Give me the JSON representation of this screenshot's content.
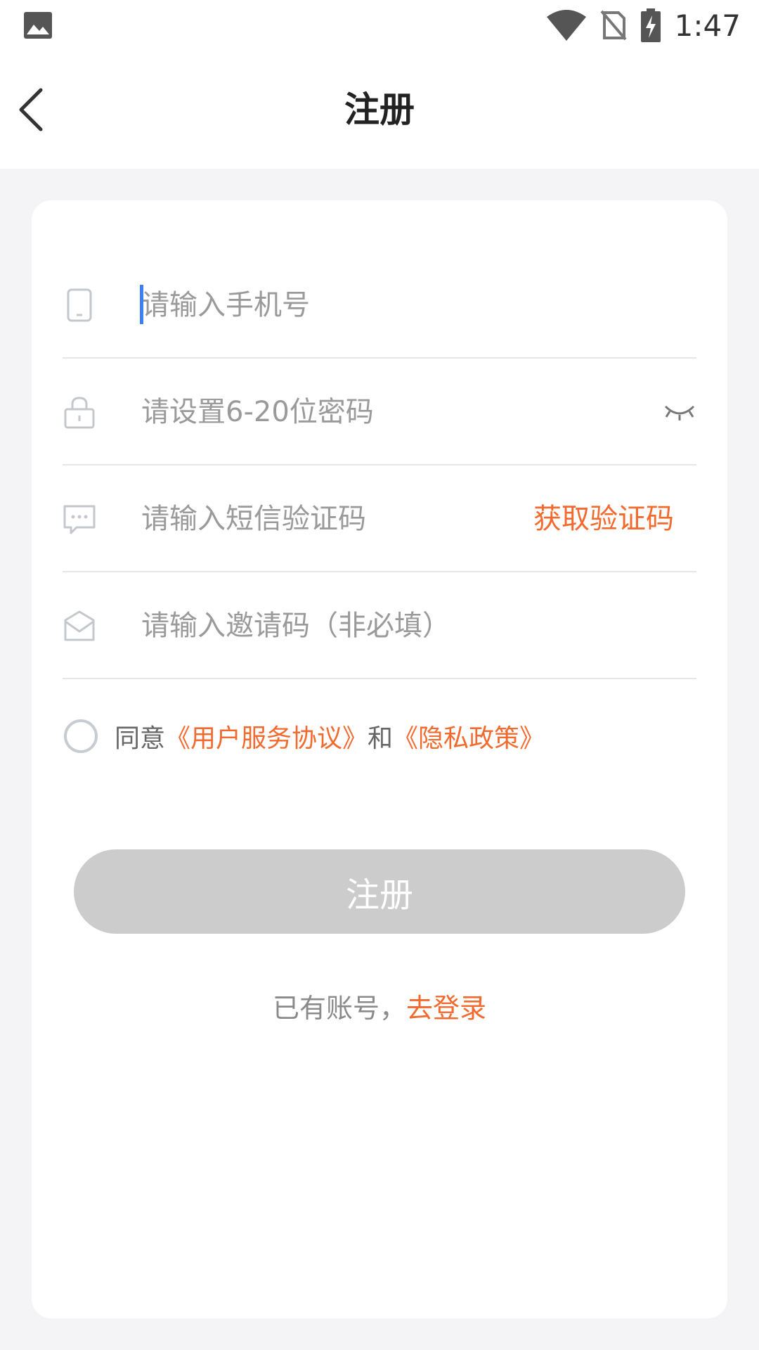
{
  "status_bar": {
    "time": "1:47",
    "icons": [
      "gallery-icon",
      "wifi-icon",
      "no-sim-icon",
      "battery-charging-icon"
    ]
  },
  "nav": {
    "title": "注册",
    "back_icon": "chevron-left-icon"
  },
  "form": {
    "phone_placeholder": "请输入手机号",
    "password_placeholder": "请设置6-20位密码",
    "sms_placeholder": "请输入短信验证码",
    "get_code_label": "获取验证码",
    "invite_placeholder": "请输入邀请码（非必填）",
    "agree": {
      "prefix": "同意",
      "terms": "《用户服务协议》",
      "and": "和",
      "privacy": "《隐私政策》"
    },
    "register_label": "注册",
    "login_prompt": "已有账号，",
    "login_link": "去登录"
  },
  "colors": {
    "accent": "#f26a2e",
    "button_disabled": "#cccccc",
    "background": "#f4f4f6",
    "caret": "#3f7ff5"
  }
}
